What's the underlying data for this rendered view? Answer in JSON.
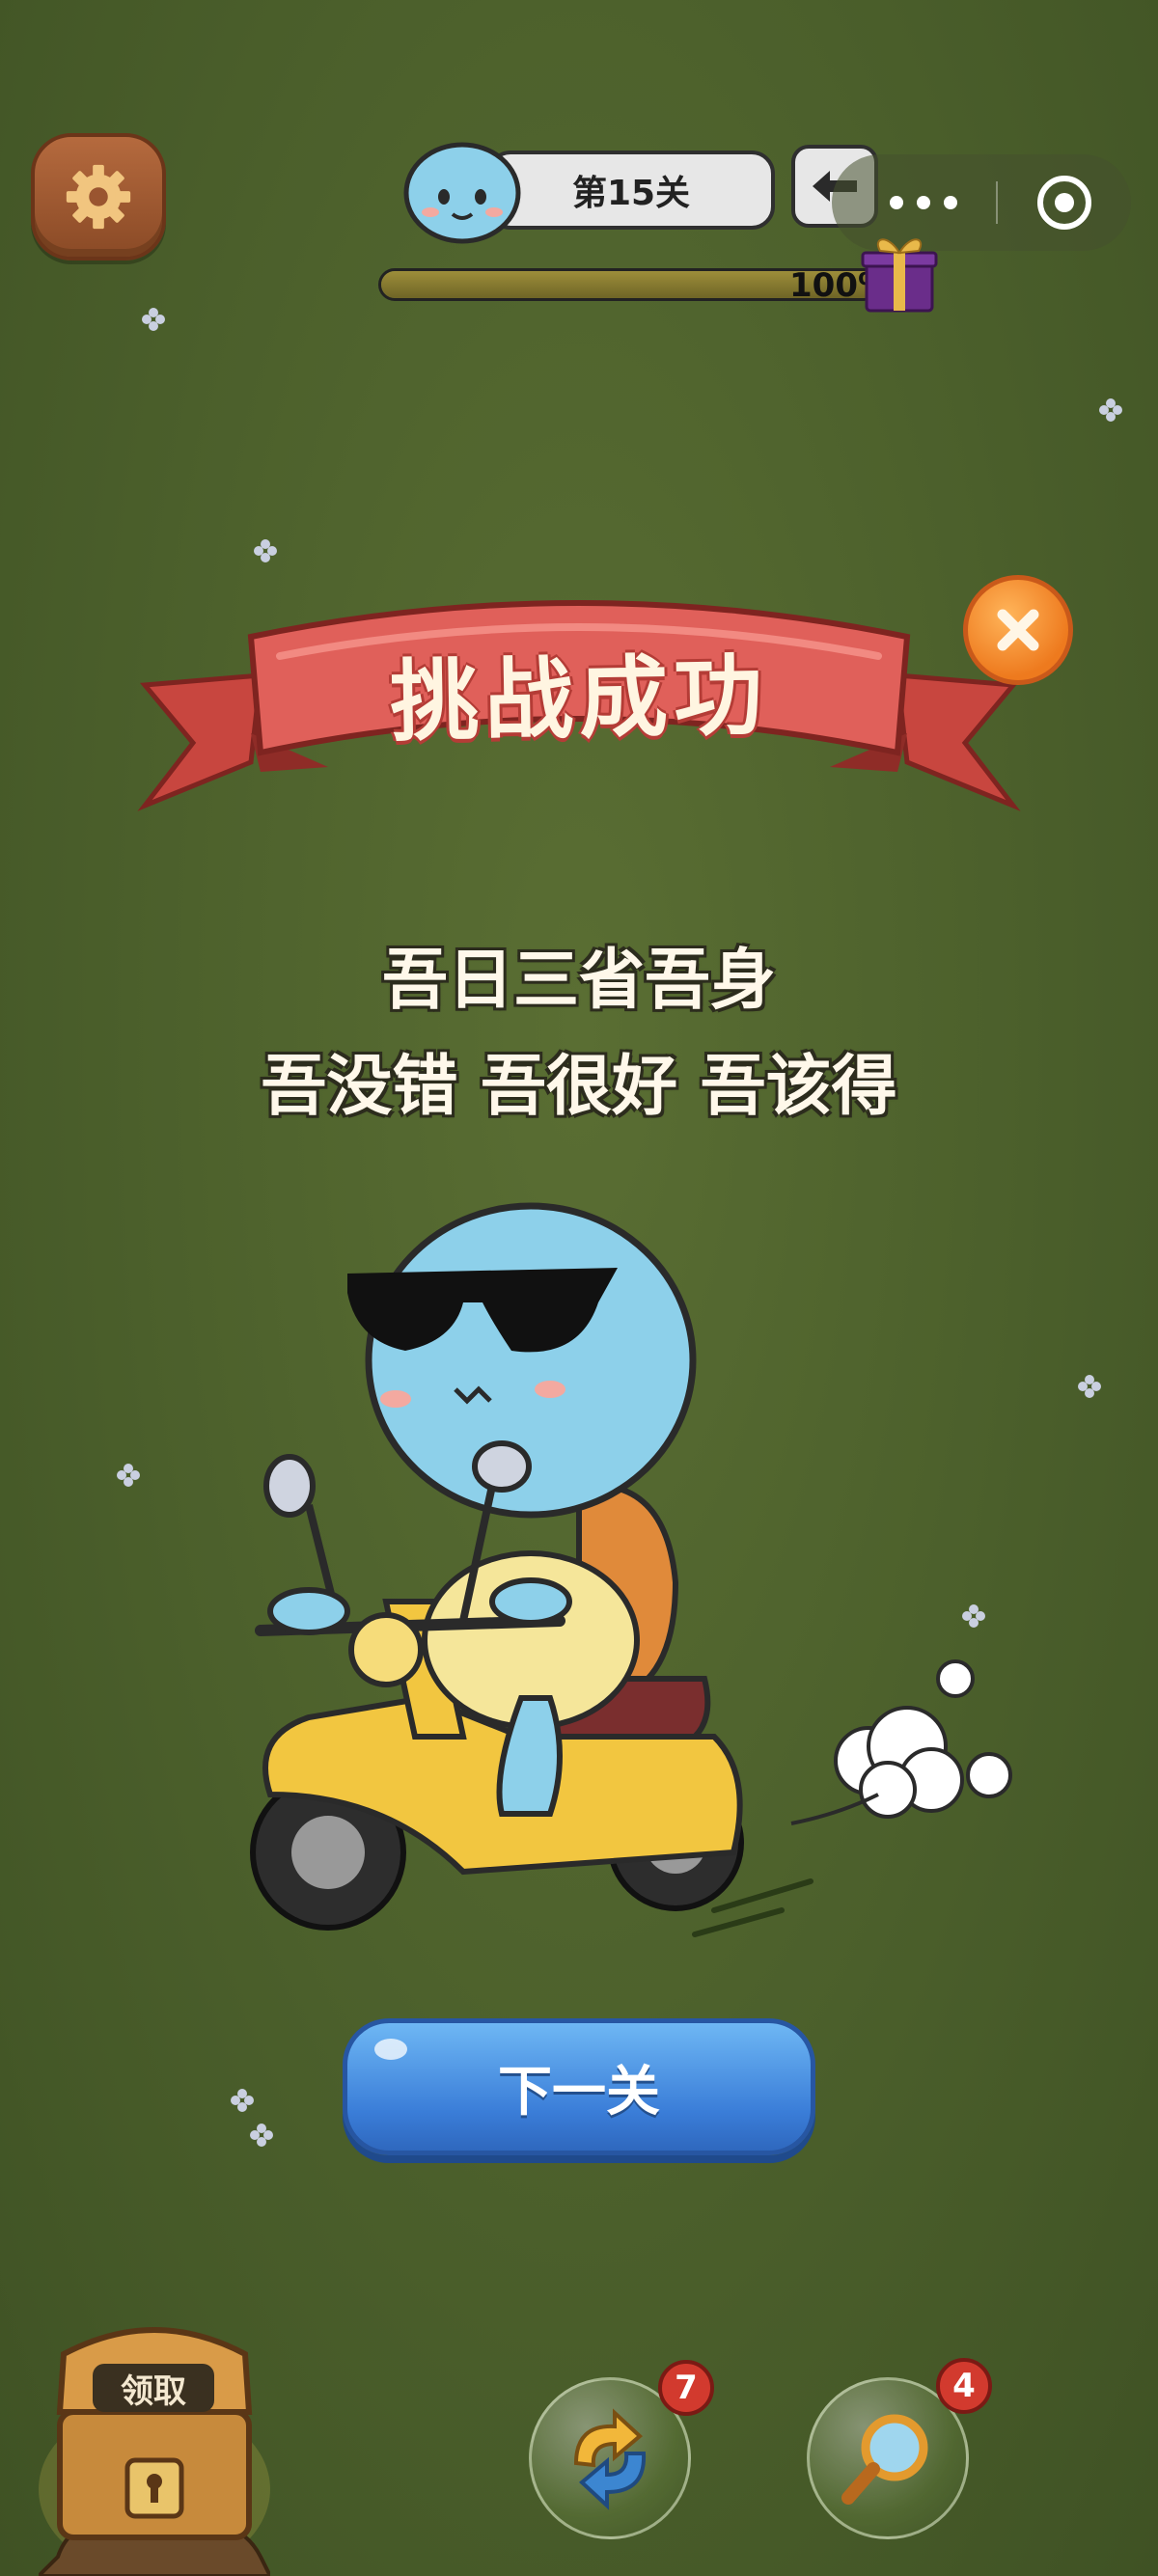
{
  "topbar": {
    "level_label": "第15关",
    "progress_text": "100%",
    "progress_fraction": 1.0
  },
  "banner": {
    "title": "挑战成功"
  },
  "quote": {
    "line1": "吾日三省吾身",
    "line2": "吾没错 吾很好 吾该得"
  },
  "actions": {
    "next_label": "下一关",
    "chest_label": "领取"
  },
  "powerups": {
    "refresh_count": "7",
    "magnifier_count": "4"
  },
  "icons": {
    "settings": "gear-icon",
    "back": "back-arrow-icon",
    "more": "more-dots-icon",
    "capsule_close": "target-icon",
    "close": "close-icon",
    "gift": "gift-box-icon",
    "refresh": "refresh-icon",
    "magnifier": "magnifier-icon",
    "chest": "treasure-chest-icon"
  },
  "colors": {
    "background": "#4b5f2b",
    "banner_red": "#e0605a",
    "button_blue": "#3a7dd8",
    "close_orange": "#ee7a1e",
    "turtle_blue": "#8dd0ea",
    "scooter_yellow": "#f2c640"
  }
}
